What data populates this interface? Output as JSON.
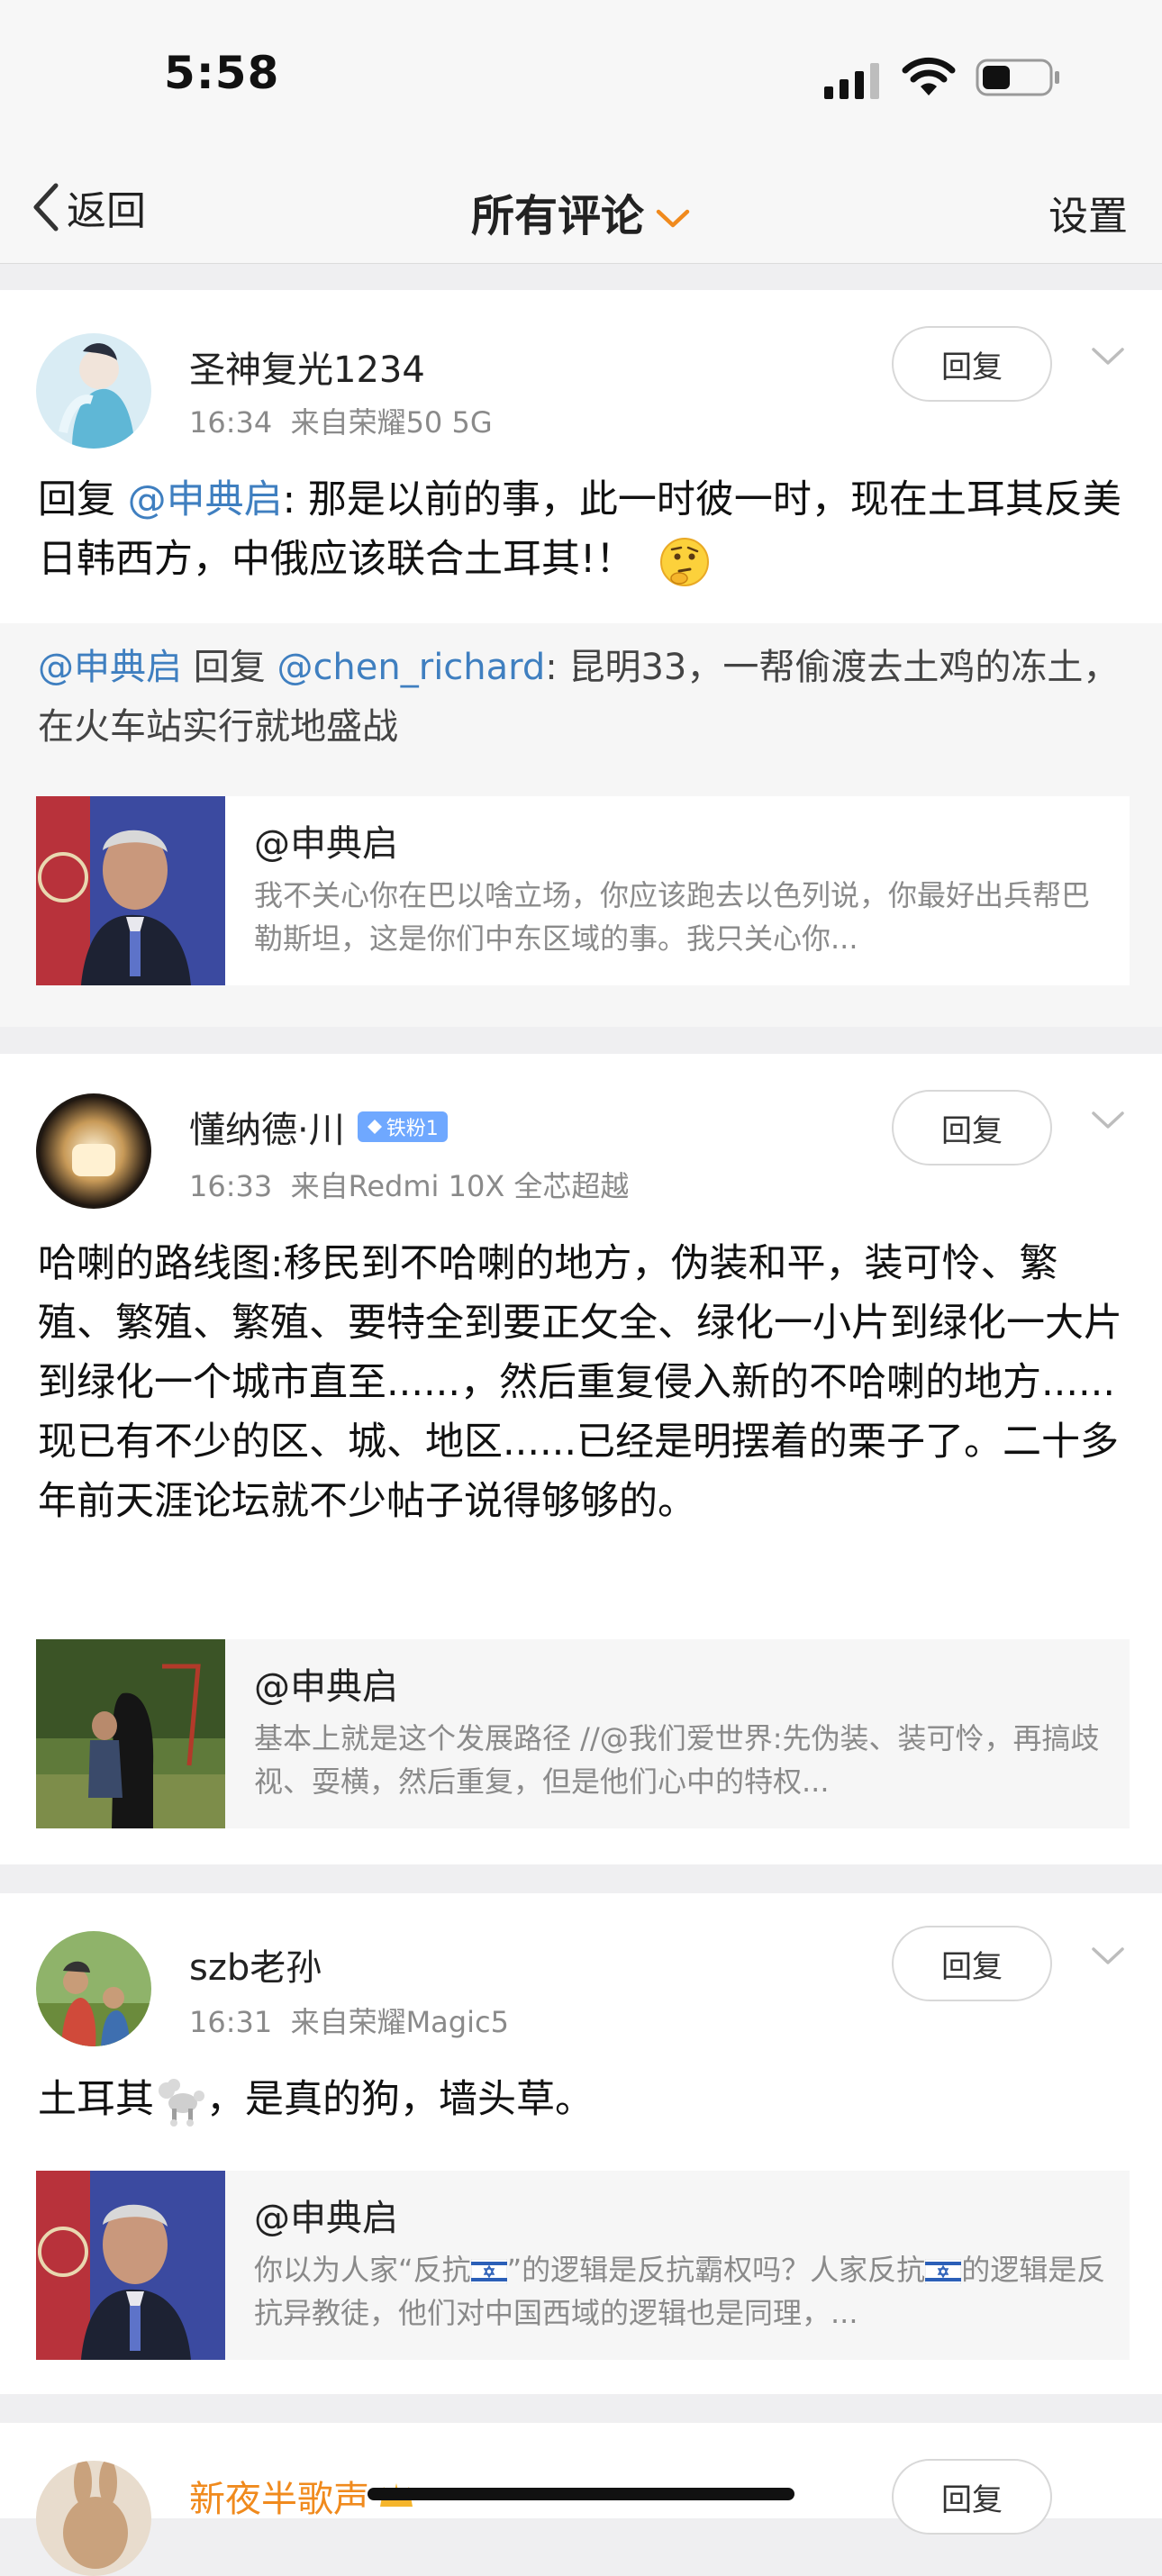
{
  "status": {
    "time": "5:58"
  },
  "nav": {
    "back_label": "返回",
    "title": "所有评论",
    "settings_label": "设置"
  },
  "colors": {
    "link": "#3f7fc0",
    "background": "#efeff1"
  },
  "comments": [
    {
      "username": "圣神复光1234",
      "time": "16:34",
      "source": "来自荣耀50 5G",
      "reply_label": "回复",
      "content_prefix": "回复",
      "content_mention": "@申典启",
      "content_text": ": 那是以前的事，此一时彼一时，现在土耳其反美日韩西方，中俄应该联合土耳其!！",
      "emoji": "thinking-face-icon",
      "quote": {
        "mention_a": "@申典启",
        "reply_word": "回复",
        "mention_b": "@chen_richard",
        "text": ": 昆明33，一帮偷渡去土鸡的冻土，在火车站实行就地盛战"
      },
      "ref": {
        "title": "@申典启",
        "summary": "我不关心你在巴以啥立场，你应该跑去以色列说，你最好出兵帮巴勒斯坦，这是你们中东区域的事。我只关心你..."
      }
    },
    {
      "username": "懂纳德·川",
      "badge": "铁粉1",
      "time": "16:33",
      "source": "来自Redmi 10X 全芯超越",
      "reply_label": "回复",
      "content_text": "哈喇的路线图:移民到不哈喇的地方，伪装和平，装可怜、繁殖、繁殖、繁殖、要特全到要正攵全、绿化一小片到绿化一大片到绿化一个城市直至......，然后重复侵入新的不哈喇的地方......现已有不少的区、城、地区......已经是明摆着的栗子了。二十多年前天涯论坛就不少帖子说得够够的。",
      "ref": {
        "title": "@申典启",
        "summary": "基本上就是这个发展路径 //@我们爱世界:先伪装、装可怜，再搞歧视、耍横，然后重复，但是他们心中的特权..."
      }
    },
    {
      "username": "szb老孙",
      "time": "16:31",
      "source": "来自荣耀Magic5",
      "reply_label": "回复",
      "content_text_a": "土耳其",
      "content_text_b": "，是真的狗，墙头草。",
      "ref": {
        "title": "@申典启",
        "summary_a": "你以为人家“反抗",
        "summary_b": "”的逻辑是反抗霸权吗？人家反抗",
        "summary_c": "的逻辑是反抗异教徒，他们对中国西域的逻辑也是同理，..."
      }
    },
    {
      "username": "新夜半歌声",
      "reply_label": "回复"
    }
  ]
}
